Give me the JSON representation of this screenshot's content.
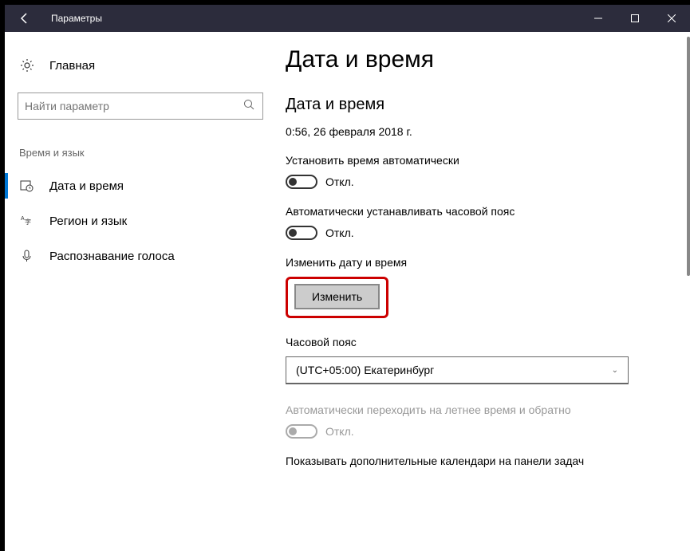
{
  "window": {
    "title": "Параметры"
  },
  "sidebar": {
    "home": "Главная",
    "search_placeholder": "Найти параметр",
    "category": "Время и язык",
    "items": [
      {
        "label": "Дата и время"
      },
      {
        "label": "Регион и язык"
      },
      {
        "label": "Распознавание голоса"
      }
    ]
  },
  "content": {
    "heading": "Дата и время",
    "subheading": "Дата и время",
    "current_datetime": "0:56, 26 февраля 2018 г.",
    "auto_time_label": "Установить время автоматически",
    "auto_time_state": "Откл.",
    "auto_tz_label": "Автоматически устанавливать часовой пояс",
    "auto_tz_state": "Откл.",
    "change_dt_label": "Изменить дату и время",
    "change_btn": "Изменить",
    "tz_label": "Часовой пояс",
    "tz_value": "(UTC+05:00) Екатеринбург",
    "dst_label": "Автоматически переходить на летнее время и обратно",
    "dst_state": "Откл.",
    "extra_cal_label": "Показывать дополнительные календари на панели задач"
  }
}
